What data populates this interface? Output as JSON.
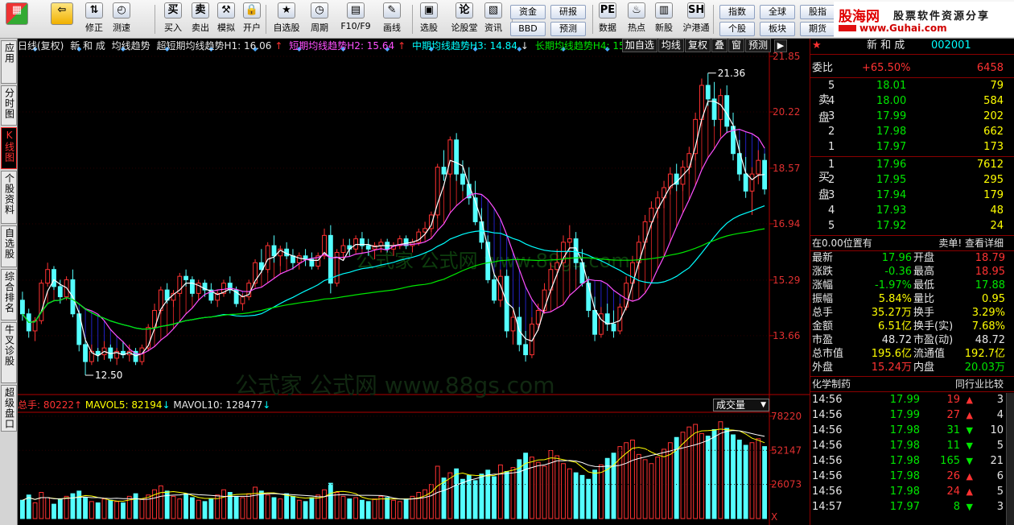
{
  "toolbar": {
    "buttons": [
      {
        "label": "",
        "icon": "windows-grid-icon"
      },
      {
        "label": "",
        "icon": "back-arrow-icon"
      },
      {
        "label": "修正",
        "icon": "up-down-arrow-icon"
      },
      {
        "label": "测速",
        "icon": "clock-icon"
      },
      {
        "label": "买入",
        "icon": "buy-icon"
      },
      {
        "label": "卖出",
        "icon": "sell-icon"
      },
      {
        "label": "模拟",
        "icon": "hammer-icon"
      },
      {
        "label": "开户",
        "icon": "lock-icon"
      },
      {
        "label": "自选股",
        "icon": "star-icon"
      },
      {
        "label": "周期",
        "icon": "period-icon"
      },
      {
        "label": "F10/F9",
        "icon": "f10-icon"
      },
      {
        "label": "画线",
        "icon": "pencil-icon"
      },
      {
        "label": "选股",
        "icon": "stock-pick-icon"
      },
      {
        "label": "论股堂",
        "icon": "forum-icon"
      },
      {
        "label": "资讯",
        "icon": "news-icon"
      },
      {
        "label": "数据",
        "icon": "pe-data-icon"
      },
      {
        "label": "热点",
        "icon": "hot-icon"
      },
      {
        "label": "新股",
        "icon": "new-stock-icon"
      },
      {
        "label": "沪港通",
        "icon": "sse-hke-icon"
      }
    ],
    "small_buttons": [
      "资金",
      "研报",
      "BBD",
      "预测",
      "指数",
      "全球",
      "股指",
      "个股",
      "板块",
      "期货"
    ],
    "brand": {
      "name": "股海网",
      "slogan": "股票软件资源分享",
      "url": "www.Guhai.com"
    }
  },
  "left_tabs": [
    {
      "label": "应用"
    },
    {
      "label": "分时图"
    },
    {
      "label": "K线图",
      "active": true
    },
    {
      "label": "个股资料"
    },
    {
      "label": "自选股"
    },
    {
      "label": "综合排名"
    },
    {
      "label": "牛叉诊股"
    },
    {
      "label": "超级盘口"
    }
  ],
  "chart": {
    "header": {
      "period": "日线(复权)",
      "stock": "新 和 成",
      "indicator": "均线趋势",
      "h1": "超短期均线趋势H1: 16.06",
      "h2": "短期均线趋势H2: 15.64",
      "h3": "中期均线趋势H3: 14.84",
      "h4": "长期均线趋势H4: 15.71",
      "controls": [
        "加自选",
        "均线",
        "复权",
        "叠",
        "窗",
        "预测"
      ]
    },
    "price_axis": [
      "21.85",
      "20.22",
      "18.57",
      "16.94",
      "15.29",
      "13.66"
    ],
    "max_label": "21.36",
    "min_label": "12.50",
    "volume_header": {
      "total": "总手: 80222",
      "ma5": "MAVOL5: 82194",
      "ma10": "MAVOL10: 128477"
    },
    "volume_selector": "成交量",
    "volume_axis": [
      "78220",
      "52147",
      "26073"
    ],
    "volume_unit": "X",
    "watermark": "公式家 公式网 www.88gs.com"
  },
  "chart_data": {
    "type": "candlestick",
    "ylim": [
      12.5,
      21.85
    ],
    "ma_series": [
      "短期",
      "中期",
      "长期"
    ],
    "ohlc": [
      [
        14.7,
        14.95,
        14.1,
        14.3
      ],
      [
        14.3,
        14.45,
        13.6,
        13.8
      ],
      [
        13.8,
        14.2,
        13.5,
        14.1
      ],
      [
        14.1,
        15.3,
        14.0,
        15.2
      ],
      [
        15.2,
        15.8,
        15.1,
        15.6
      ],
      [
        15.6,
        15.7,
        15.0,
        15.1
      ],
      [
        15.1,
        15.3,
        14.6,
        14.8
      ],
      [
        14.8,
        15.4,
        14.7,
        15.3
      ],
      [
        15.3,
        15.6,
        14.2,
        14.3
      ],
      [
        14.3,
        14.4,
        13.2,
        13.4
      ],
      [
        13.4,
        13.6,
        12.5,
        12.9
      ],
      [
        12.9,
        13.4,
        12.8,
        13.2
      ],
      [
        13.2,
        13.3,
        12.9,
        13.1
      ],
      [
        13.1,
        13.5,
        12.95,
        13.3
      ],
      [
        13.3,
        13.4,
        12.9,
        13.0
      ],
      [
        13.0,
        13.3,
        12.8,
        13.2
      ],
      [
        13.2,
        13.5,
        13.0,
        13.1
      ],
      [
        13.1,
        13.4,
        12.9,
        13.2
      ],
      [
        13.2,
        13.3,
        12.8,
        12.9
      ],
      [
        12.9,
        13.4,
        12.8,
        13.3
      ],
      [
        13.3,
        14.0,
        13.2,
        13.9
      ],
      [
        13.9,
        14.6,
        13.8,
        14.4
      ],
      [
        14.4,
        15.1,
        14.3,
        15.0
      ],
      [
        15.0,
        15.2,
        14.6,
        14.7
      ],
      [
        14.7,
        15.0,
        14.5,
        14.9
      ],
      [
        14.9,
        15.5,
        14.8,
        15.4
      ],
      [
        15.4,
        15.6,
        15.1,
        15.3
      ],
      [
        15.3,
        15.4,
        14.8,
        14.9
      ],
      [
        14.9,
        15.3,
        14.7,
        15.2
      ],
      [
        15.2,
        15.3,
        14.8,
        15.0
      ],
      [
        15.0,
        15.2,
        14.6,
        14.7
      ],
      [
        14.7,
        15.0,
        14.5,
        14.9
      ],
      [
        14.9,
        15.3,
        14.8,
        15.2
      ],
      [
        15.2,
        15.4,
        14.9,
        15.0
      ],
      [
        15.0,
        15.1,
        14.5,
        14.6
      ],
      [
        14.6,
        14.9,
        14.4,
        14.8
      ],
      [
        14.8,
        15.3,
        14.7,
        15.2
      ],
      [
        15.2,
        15.9,
        15.1,
        15.8
      ],
      [
        15.8,
        16.2,
        15.5,
        15.6
      ],
      [
        15.6,
        16.4,
        15.5,
        16.3
      ],
      [
        16.3,
        16.6,
        15.8,
        16.0
      ],
      [
        16.0,
        16.3,
        15.7,
        16.2
      ],
      [
        16.2,
        16.4,
        15.9,
        16.0
      ],
      [
        16.0,
        16.2,
        15.6,
        15.8
      ],
      [
        15.8,
        16.1,
        15.6,
        16.0
      ],
      [
        16.0,
        16.2,
        15.7,
        15.9
      ],
      [
        15.9,
        16.1,
        15.6,
        15.7
      ],
      [
        15.7,
        16.1,
        15.6,
        16.0
      ],
      [
        16.0,
        16.8,
        15.9,
        16.6
      ],
      [
        16.6,
        16.9,
        14.9,
        15.2
      ],
      [
        15.2,
        16.2,
        15.1,
        16.1
      ],
      [
        16.1,
        16.5,
        15.9,
        16.3
      ],
      [
        16.3,
        16.5,
        16.0,
        16.2
      ],
      [
        16.2,
        16.6,
        16.1,
        16.5
      ],
      [
        16.5,
        16.7,
        16.2,
        16.3
      ],
      [
        16.3,
        16.5,
        16.0,
        16.2
      ],
      [
        16.2,
        16.4,
        15.9,
        16.3
      ],
      [
        16.3,
        16.5,
        16.1,
        16.4
      ],
      [
        16.4,
        16.5,
        16.1,
        16.2
      ],
      [
        16.2,
        16.4,
        16.0,
        16.3
      ],
      [
        16.3,
        16.6,
        16.2,
        16.5
      ],
      [
        16.5,
        16.6,
        16.2,
        16.3
      ],
      [
        16.3,
        16.5,
        16.1,
        16.4
      ],
      [
        16.4,
        16.8,
        16.3,
        16.7
      ],
      [
        16.7,
        17.0,
        16.5,
        16.8
      ],
      [
        16.8,
        17.3,
        16.7,
        17.2
      ],
      [
        17.2,
        18.7,
        17.1,
        18.6
      ],
      [
        18.6,
        19.1,
        18.2,
        18.4
      ],
      [
        18.4,
        19.5,
        18.3,
        19.4
      ],
      [
        19.4,
        19.6,
        18.2,
        18.4
      ],
      [
        18.4,
        18.8,
        17.9,
        18.1
      ],
      [
        18.1,
        18.6,
        17.5,
        17.7
      ],
      [
        17.7,
        18.2,
        16.9,
        17.0
      ],
      [
        17.0,
        17.4,
        16.2,
        16.4
      ],
      [
        16.4,
        16.6,
        15.2,
        15.3
      ],
      [
        15.3,
        15.5,
        14.6,
        14.7
      ],
      [
        14.7,
        15.6,
        14.5,
        15.4
      ],
      [
        15.4,
        15.6,
        13.6,
        13.8
      ],
      [
        13.8,
        14.4,
        13.4,
        14.2
      ],
      [
        14.2,
        14.5,
        13.2,
        13.4
      ],
      [
        13.4,
        13.8,
        12.9,
        13.1
      ],
      [
        13.1,
        14.2,
        13.0,
        14.0
      ],
      [
        14.0,
        14.6,
        13.8,
        14.4
      ],
      [
        14.4,
        15.2,
        14.3,
        15.0
      ],
      [
        15.0,
        15.8,
        14.9,
        15.6
      ],
      [
        15.6,
        16.2,
        15.4,
        15.8
      ],
      [
        15.8,
        16.6,
        15.6,
        16.4
      ],
      [
        16.4,
        16.9,
        16.2,
        16.5
      ],
      [
        16.5,
        16.7,
        15.6,
        15.8
      ],
      [
        15.8,
        16.2,
        15.1,
        15.2
      ],
      [
        15.2,
        15.4,
        14.2,
        14.4
      ],
      [
        14.4,
        14.8,
        13.5,
        13.7
      ],
      [
        13.7,
        14.5,
        13.6,
        14.3
      ],
      [
        14.3,
        14.6,
        13.8,
        14.0
      ],
      [
        14.0,
        14.4,
        13.6,
        13.8
      ],
      [
        13.8,
        14.6,
        13.7,
        14.5
      ],
      [
        14.5,
        15.4,
        14.4,
        15.2
      ],
      [
        15.2,
        16.0,
        15.1,
        15.8
      ],
      [
        15.8,
        16.6,
        15.6,
        16.4
      ],
      [
        16.4,
        17.2,
        16.2,
        17.0
      ],
      [
        17.0,
        17.6,
        16.8,
        17.4
      ],
      [
        17.4,
        17.9,
        17.1,
        17.7
      ],
      [
        17.7,
        18.2,
        17.4,
        18.0
      ],
      [
        18.0,
        18.6,
        17.8,
        18.4
      ],
      [
        18.4,
        18.7,
        17.9,
        18.1
      ],
      [
        18.1,
        18.8,
        17.9,
        18.6
      ],
      [
        18.6,
        19.2,
        18.4,
        19.0
      ],
      [
        19.0,
        20.2,
        18.8,
        20.0
      ],
      [
        20.0,
        21.2,
        19.8,
        21.0
      ],
      [
        21.0,
        21.36,
        20.4,
        20.6
      ],
      [
        20.6,
        21.1,
        19.8,
        20.0
      ],
      [
        20.0,
        20.9,
        19.5,
        20.7
      ],
      [
        20.7,
        21.0,
        19.6,
        19.8
      ],
      [
        19.8,
        20.2,
        18.8,
        19.0
      ],
      [
        19.0,
        19.4,
        18.2,
        18.4
      ],
      [
        18.4,
        18.9,
        17.7,
        17.9
      ],
      [
        17.9,
        18.6,
        17.2,
        18.4
      ],
      [
        18.4,
        19.1,
        18.1,
        18.8
      ],
      [
        18.8,
        19.0,
        17.8,
        17.96
      ]
    ],
    "volume": [
      14,
      18,
      12,
      20,
      16,
      11,
      15,
      17,
      19,
      21,
      16,
      13,
      12,
      15,
      14,
      13,
      12,
      17,
      19,
      15,
      18,
      22,
      25,
      21,
      17,
      15,
      19,
      16,
      14,
      13,
      15,
      18,
      22,
      20,
      17,
      16,
      19,
      24,
      21,
      18,
      16,
      15,
      19,
      17,
      14,
      13,
      16,
      18,
      22,
      27,
      20,
      17,
      15,
      16,
      14,
      13,
      15,
      17,
      16,
      14,
      13,
      15,
      17,
      20,
      22,
      26,
      40,
      31,
      35,
      38,
      30,
      33,
      29,
      34,
      37,
      32,
      41,
      36,
      39,
      45,
      50,
      47,
      43,
      40,
      52,
      48,
      42,
      38,
      35,
      33,
      30,
      37,
      41,
      46,
      50,
      55,
      58,
      60,
      49,
      45,
      42,
      47,
      53,
      58,
      62,
      66,
      70,
      72,
      65,
      63,
      68,
      74,
      69,
      64,
      60,
      56,
      58,
      61,
      55
    ],
    "volume_bar_cap": 78220,
    "volume_ylim": [
      0,
      80000
    ]
  },
  "quote_panel": {
    "stock": "新 和 成",
    "code": "002001",
    "webi": {
      "label": "委比",
      "value": "+65.50%",
      "diff": "6458"
    },
    "sell_label": "卖盘",
    "buy_label": "买盘",
    "sell": [
      {
        "lvl": "5",
        "price": "18.01",
        "vol": "79"
      },
      {
        "lvl": "4",
        "price": "18.00",
        "vol": "584"
      },
      {
        "lvl": "3",
        "price": "17.99",
        "vol": "202"
      },
      {
        "lvl": "2",
        "price": "17.98",
        "vol": "662"
      },
      {
        "lvl": "1",
        "price": "17.97",
        "vol": "173"
      }
    ],
    "buy": [
      {
        "lvl": "1",
        "price": "17.96",
        "vol": "7612"
      },
      {
        "lvl": "2",
        "price": "17.95",
        "vol": "295"
      },
      {
        "lvl": "3",
        "price": "17.94",
        "vol": "179"
      },
      {
        "lvl": "4",
        "price": "17.93",
        "vol": "48"
      },
      {
        "lvl": "5",
        "price": "17.92",
        "vol": "24"
      }
    ],
    "position_label": "在0.00位置有",
    "link_label": "卖单! 查看详细",
    "stats": [
      {
        "k1": "最新",
        "v1": "17.96",
        "c1": "grn",
        "k2": "开盘",
        "v2": "18.79",
        "c2": "red"
      },
      {
        "k1": "涨跌",
        "v1": "-0.36",
        "c1": "grn",
        "k2": "最高",
        "v2": "18.95",
        "c2": "red"
      },
      {
        "k1": "涨幅",
        "v1": "-1.97%",
        "c1": "grn",
        "k2": "最低",
        "v2": "17.88",
        "c2": "grn"
      },
      {
        "k1": "振幅",
        "v1": "5.84%",
        "c1": "yel",
        "k2": "量比",
        "v2": "0.95",
        "c2": "yel"
      },
      {
        "k1": "总手",
        "v1": "35.27万",
        "c1": "yel",
        "k2": "换手",
        "v2": "3.29%",
        "c2": "yel"
      },
      {
        "k1": "金额",
        "v1": "6.51亿",
        "c1": "yel",
        "k2": "换手(实)",
        "v2": "7.68%",
        "c2": "yel"
      },
      {
        "k1": "市盈",
        "v1": "48.72",
        "c1": "wht",
        "k2": "市盈(动)",
        "v2": "48.72",
        "c2": "wht"
      },
      {
        "k1": "总市值",
        "v1": "195.6亿",
        "c1": "yel",
        "k2": "流通值",
        "v2": "192.7亿",
        "c2": "yel"
      },
      {
        "k1": "外盘",
        "v1": "15.24万",
        "c1": "red",
        "k2": "内盘",
        "v2": "20.03万",
        "c2": "grn"
      }
    ],
    "industry_label": "化学制药",
    "industry_link": "同行业比较",
    "ticks": [
      {
        "time": "14:56",
        "price": "17.99",
        "vol": "19",
        "dir": "up",
        "count": "3"
      },
      {
        "time": "14:56",
        "price": "17.99",
        "vol": "27",
        "dir": "up",
        "count": "4"
      },
      {
        "time": "14:56",
        "price": "17.98",
        "vol": "31",
        "dir": "down",
        "count": "10"
      },
      {
        "time": "14:56",
        "price": "17.98",
        "vol": "11",
        "dir": "down",
        "count": "5"
      },
      {
        "time": "14:56",
        "price": "17.98",
        "vol": "165",
        "dir": "down",
        "count": "21"
      },
      {
        "time": "14:56",
        "price": "17.98",
        "vol": "26",
        "dir": "up",
        "count": "6"
      },
      {
        "time": "14:56",
        "price": "17.98",
        "vol": "24",
        "dir": "up",
        "count": "5"
      },
      {
        "time": "14:57",
        "price": "17.97",
        "vol": "8",
        "dir": "down",
        "count": "3"
      }
    ]
  },
  "colors": {
    "up": "#ff3232",
    "down": "#54ffff",
    "ma_short": "#ff50ff",
    "ma_mid": "#00ffff",
    "ma_long": "#00e600",
    "ma_fast": "#ffffff",
    "axis": "#b00000"
  }
}
